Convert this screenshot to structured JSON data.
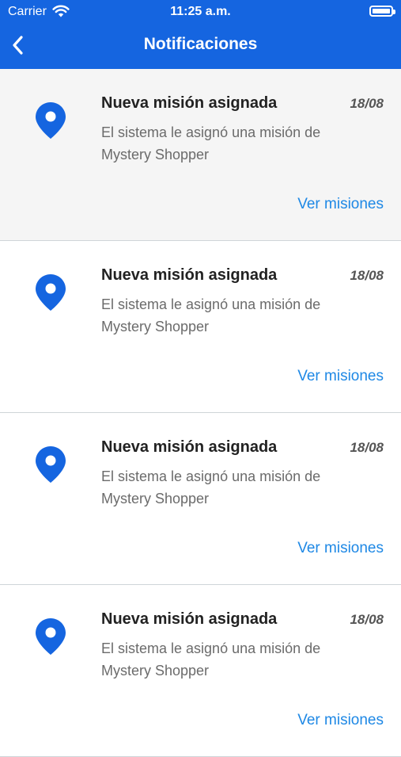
{
  "status_bar": {
    "carrier": "Carrier",
    "time": "11:25 a.m."
  },
  "nav": {
    "title": "Notificaciones",
    "back_icon": "chevron-left-icon"
  },
  "colors": {
    "header_bg": "#1565e0",
    "accent": "#1e88e5",
    "pin": "#1565e0"
  },
  "notifications": [
    {
      "title": "Nueva misión asignada",
      "date": "18/08",
      "description": "El sistema le asignó una misión de Mystery Shopper",
      "action": "Ver misiones",
      "icon": "location-pin-icon"
    },
    {
      "title": "Nueva misión asignada",
      "date": "18/08",
      "description": "El sistema le asignó una misión de Mystery Shopper",
      "action": "Ver misiones",
      "icon": "location-pin-icon"
    },
    {
      "title": "Nueva misión asignada",
      "date": "18/08",
      "description": "El sistema le asignó una misión de Mystery Shopper",
      "action": "Ver misiones",
      "icon": "location-pin-icon"
    },
    {
      "title": "Nueva misión asignada",
      "date": "18/08",
      "description": "El sistema le asignó una misión de Mystery Shopper",
      "action": "Ver misiones",
      "icon": "location-pin-icon"
    }
  ]
}
